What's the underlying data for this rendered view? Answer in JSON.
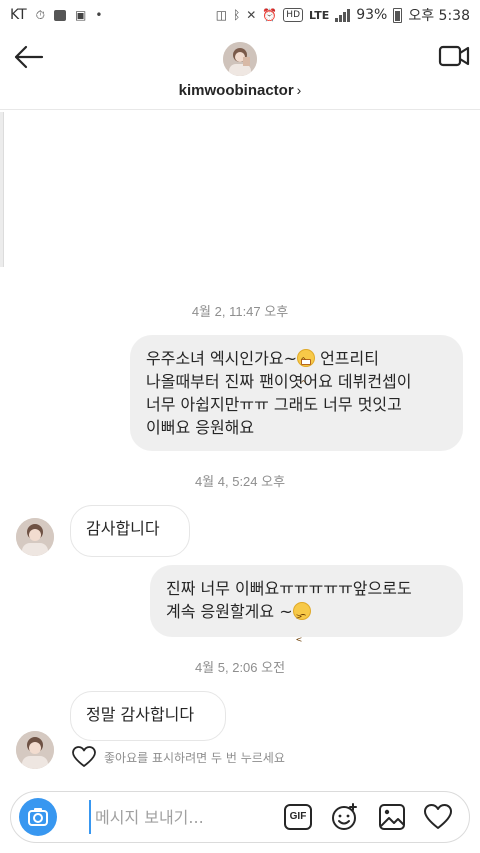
{
  "status_bar": {
    "carrier": "KT",
    "network": "LTE",
    "battery": "93%",
    "time": "오후 5:38"
  },
  "header": {
    "username": "kimwoobinactor",
    "chevron": "›"
  },
  "messages": [
    {
      "type": "timestamp",
      "text": "4월 2, 11:47 오후"
    },
    {
      "type": "outgoing",
      "lines": [
        "우주소녀 엑시인가요~",
        "나올때부터 진짜 팬이엿어요 데뷔컨셉이",
        "너무 아쉽지만ㅠㅠ 그래도 너무 멋잇고",
        "이뻐요 응원해요"
      ],
      "line1_suffix": " 언프리티",
      "emoji": "grinning-face-emoji"
    },
    {
      "type": "timestamp",
      "text": "4월 4, 5:24 오후"
    },
    {
      "type": "incoming",
      "text": "감사합니다"
    },
    {
      "type": "outgoing",
      "lines": [
        "진짜 너무 이뻐요ㅠㅠㅠㅠㅠ앞으로도",
        "계속 응원할게요 ~"
      ],
      "emoji": "persevering-face-emoji"
    },
    {
      "type": "timestamp",
      "text": "4월 5, 2:06 오전"
    },
    {
      "type": "incoming",
      "text": "정말 감사합니다"
    }
  ],
  "like_hint": "좋아요를 표시하려면 두 번 누르세요",
  "composer": {
    "placeholder": "메시지 보내기...",
    "gif_label": "GIF"
  },
  "colors": {
    "accent": "#3897f0",
    "outgoing_bubble": "#efefef",
    "timestamp": "#8e8e8e"
  },
  "icons": [
    "back-arrow-icon",
    "video-call-icon",
    "camera-icon",
    "sticker-icon",
    "image-icon",
    "heart-icon"
  ]
}
